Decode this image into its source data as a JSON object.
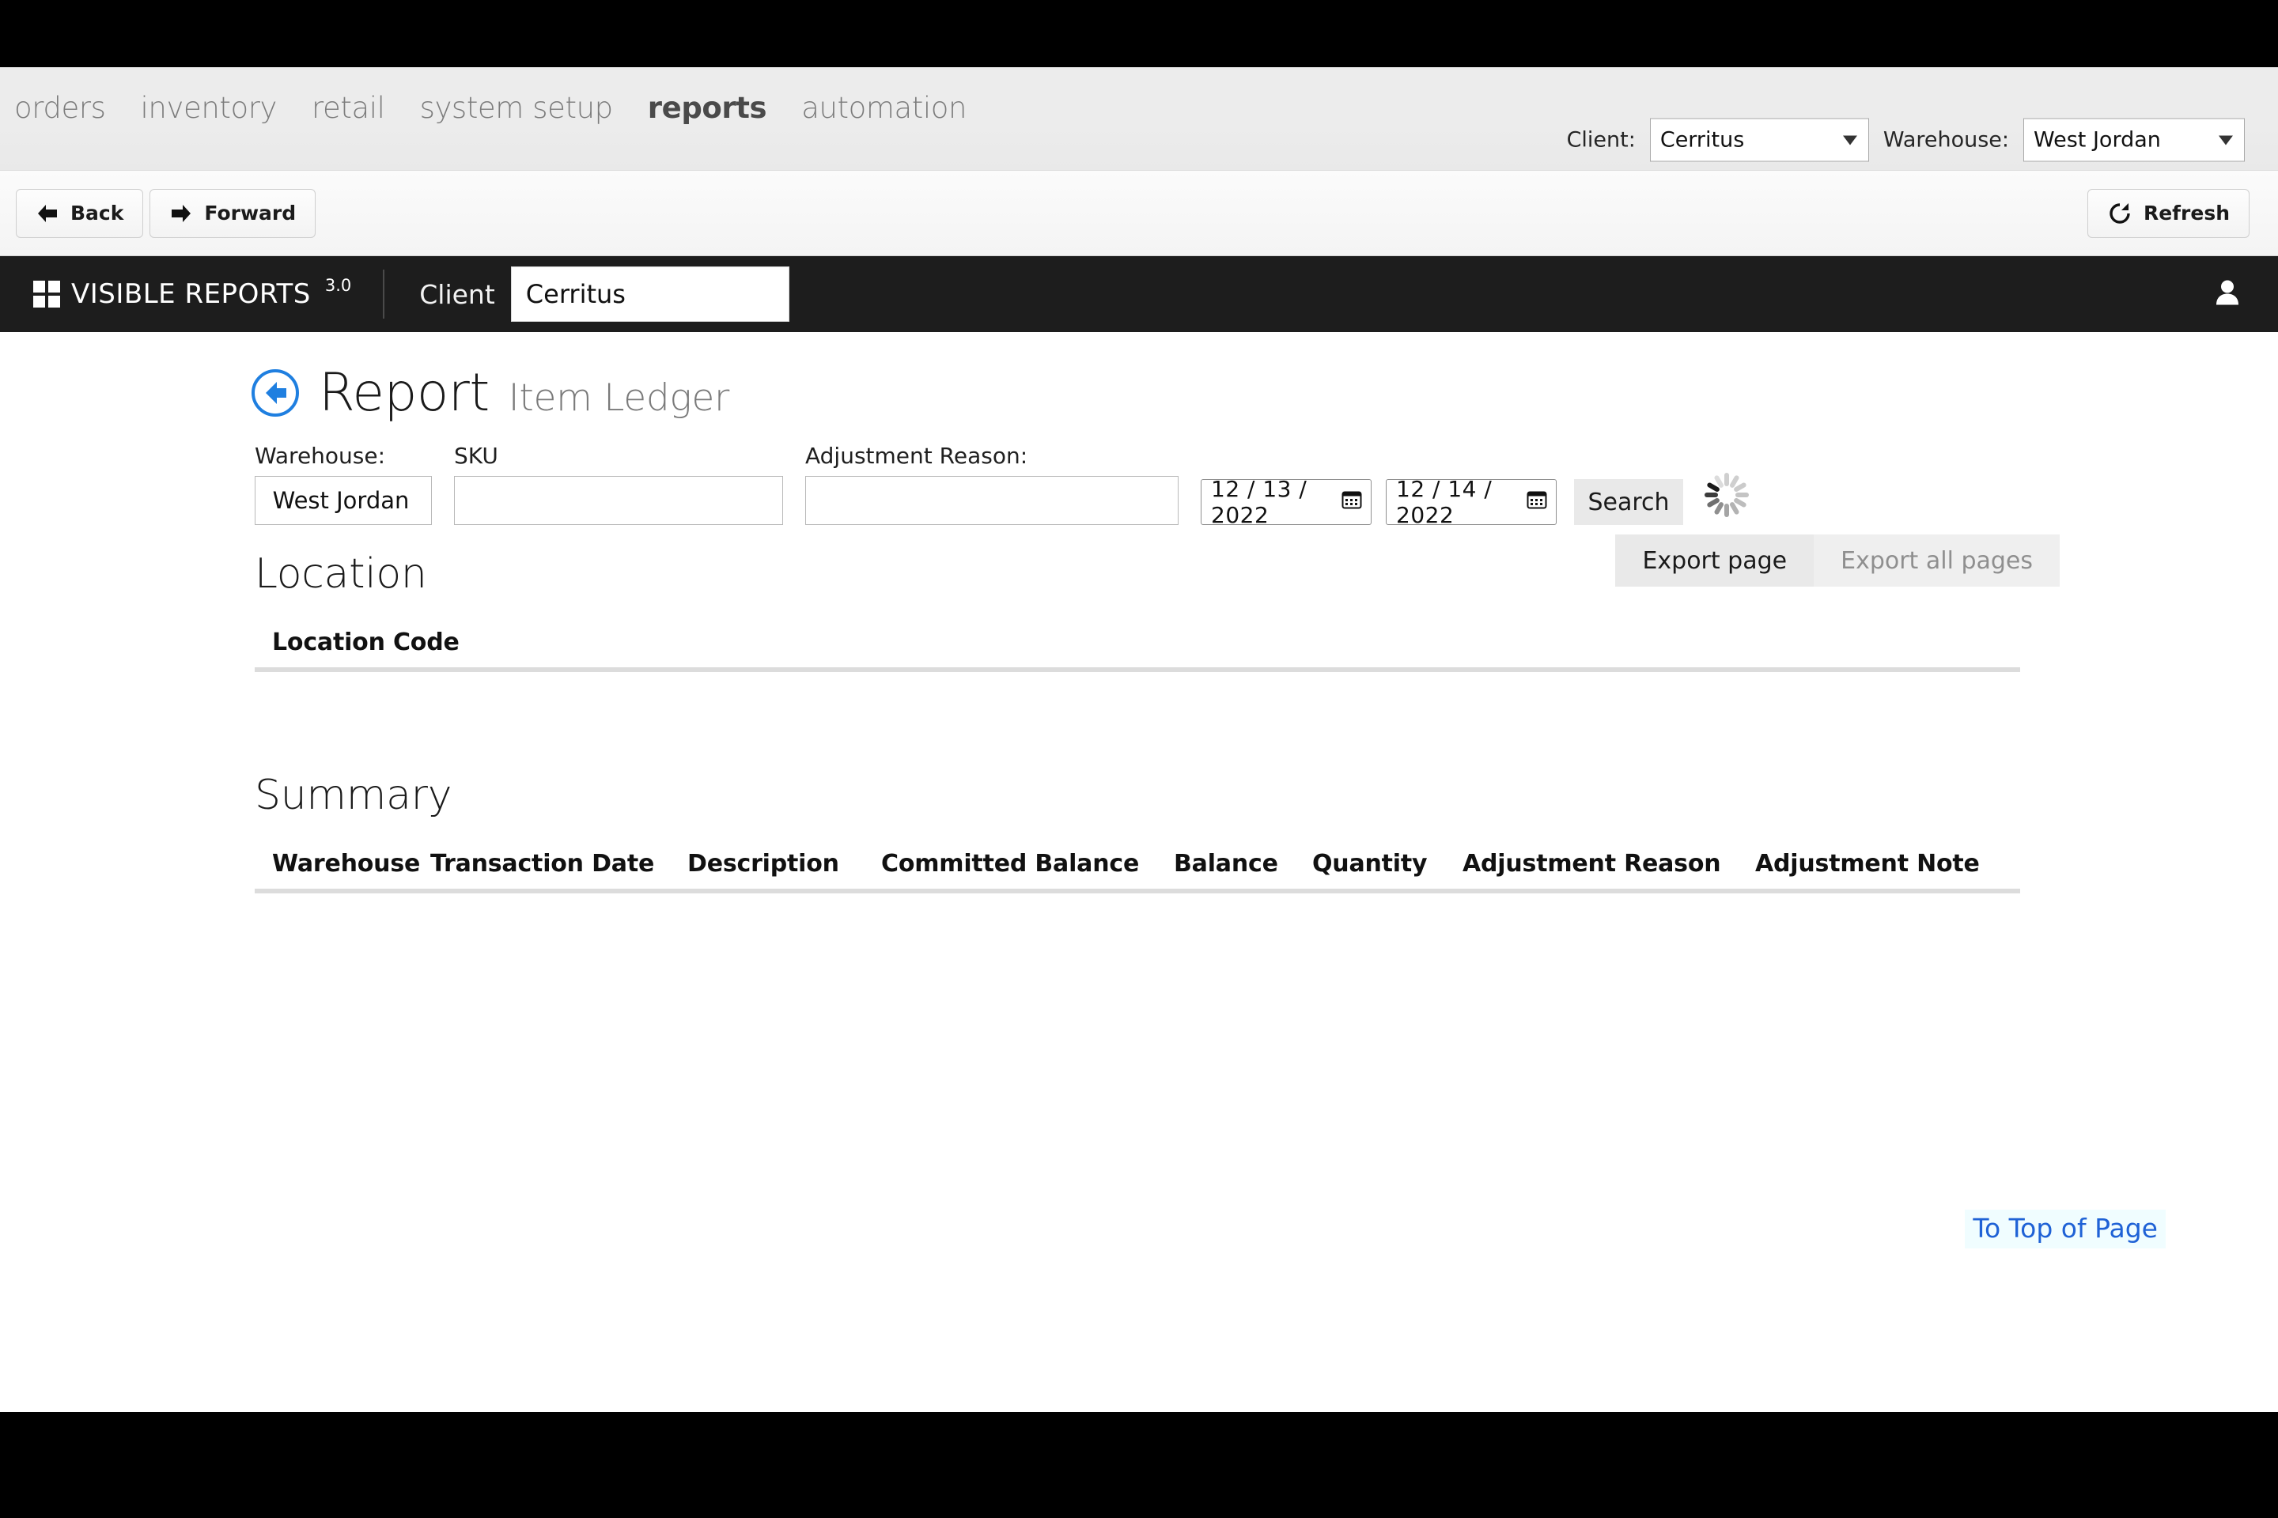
{
  "browser_nav": {
    "links": [
      {
        "label": "orders",
        "active": false
      },
      {
        "label": "inventory",
        "active": false
      },
      {
        "label": "retail",
        "active": false
      },
      {
        "label": "system setup",
        "active": false
      },
      {
        "label": "reports",
        "active": true
      },
      {
        "label": "automation",
        "active": false
      }
    ],
    "client_label": "Client:",
    "client_value": "Cerritus",
    "warehouse_label": "Warehouse:",
    "warehouse_value": "West Jordan"
  },
  "toolbar": {
    "back_label": "Back",
    "forward_label": "Forward",
    "refresh_label": "Refresh"
  },
  "brandbar": {
    "product_name": "VISIBLE REPORTS",
    "version": "3.0",
    "client_label": "Client",
    "client_value": "Cerritus"
  },
  "report": {
    "title": "Report",
    "subtitle": "Item Ledger"
  },
  "filters": {
    "warehouse_label": "Warehouse:",
    "warehouse_value": "West Jordan",
    "sku_label": "SKU",
    "sku_value": "",
    "sku_placeholder": "",
    "reason_label": "Adjustment Reason:",
    "reason_value": "",
    "reason_placeholder": "",
    "date_from": "12 / 13 / 2022",
    "date_to": "12 / 14 / 2022",
    "search_label": "Search"
  },
  "export": {
    "page_label": "Export page",
    "all_label": "Export all pages"
  },
  "location_section": {
    "heading": "Location",
    "columns": [
      "Location Code"
    ],
    "rows": []
  },
  "summary_section": {
    "heading": "Summary",
    "columns": [
      "Warehouse",
      "Transaction Date",
      "Description",
      "Committed Balance",
      "Balance",
      "Quantity",
      "Adjustment Reason",
      "Adjustment Note"
    ],
    "rows": []
  },
  "footer_link": {
    "label": "To Top of Page"
  },
  "colors": {
    "brand_bar": "#1d1d1d",
    "accent_blue": "#1f7fe0",
    "link_blue": "#1f62d6",
    "link_bg": "#f0fdff",
    "nav_text": "#7c7c7c",
    "rule": "#dcdcdc"
  }
}
